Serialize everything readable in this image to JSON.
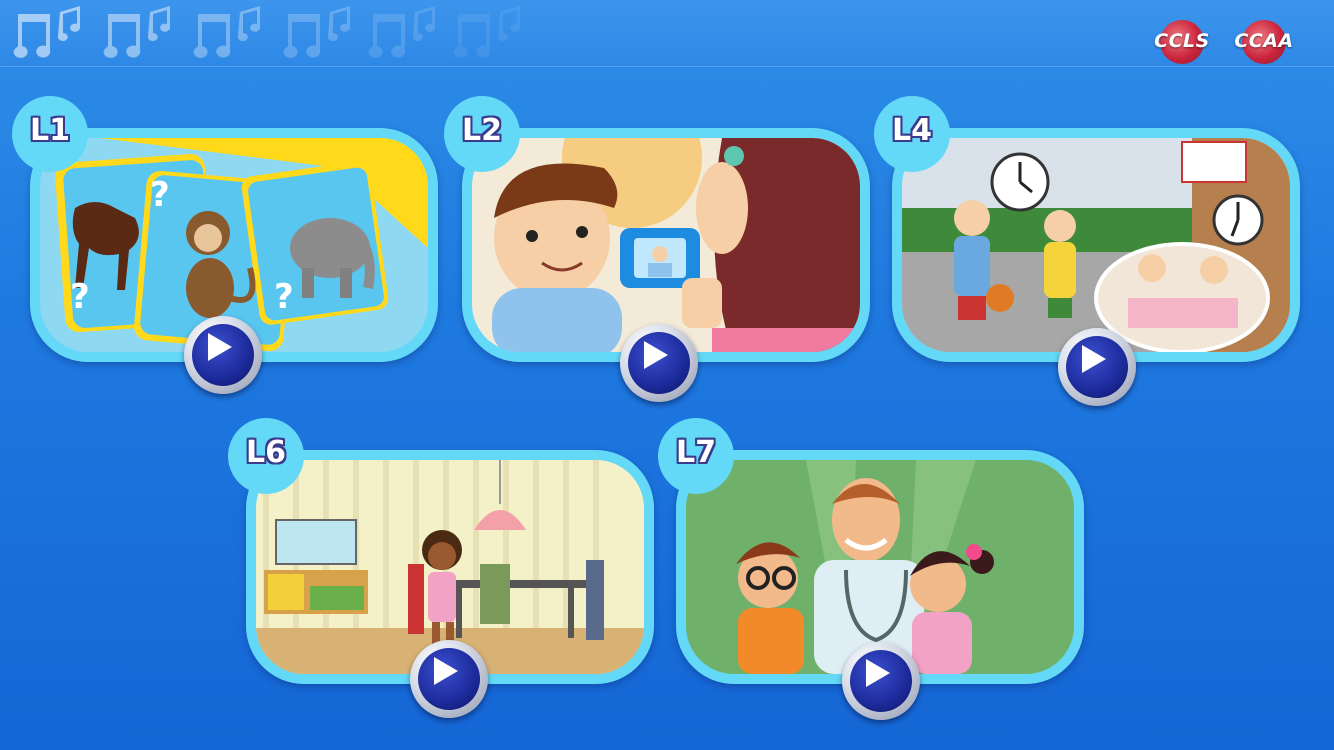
{
  "header": {
    "logos": [
      {
        "text": "CCLS"
      },
      {
        "text": "CCAA"
      }
    ]
  },
  "lessons": [
    {
      "label": "L1",
      "scene": "animal-cards"
    },
    {
      "label": "L2",
      "scene": "boy-and-girl-with-camera"
    },
    {
      "label": "L4",
      "scene": "basketball-and-dinner-with-clocks"
    },
    {
      "label": "L6",
      "scene": "girl-in-dining-room"
    },
    {
      "label": "L7",
      "scene": "doctor-with-children"
    }
  ],
  "colors": {
    "background": "#1f7ae0",
    "card_frame": "#63d9f7",
    "label_outline": "#3a3a8e",
    "play_button": "#1c2a9a"
  }
}
